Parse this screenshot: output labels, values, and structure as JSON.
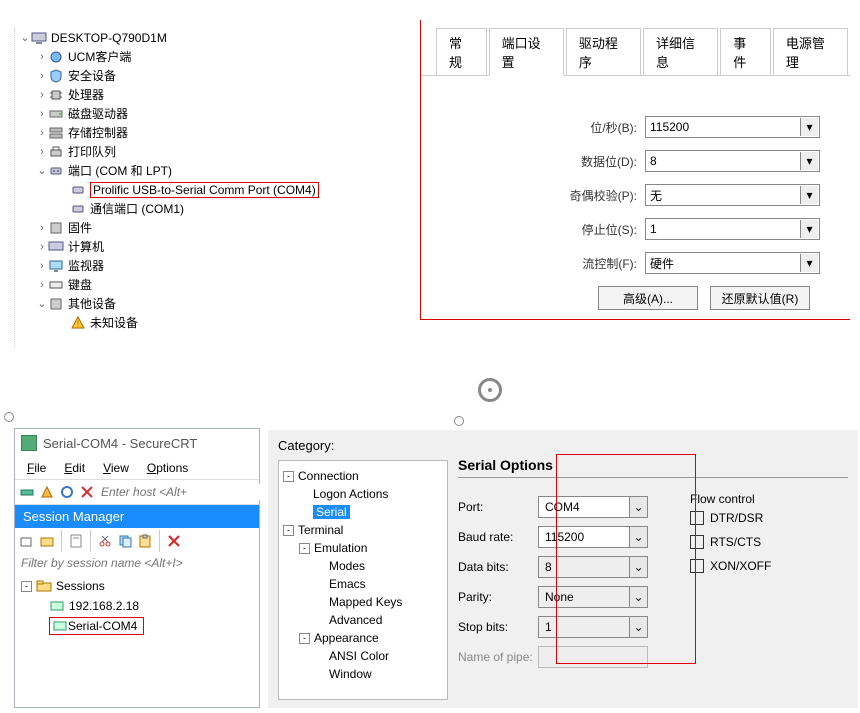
{
  "devmgr": {
    "computer": "DESKTOP-Q790D1M",
    "nodes": {
      "ucm": "UCM客户端",
      "security": "安全设备",
      "cpu": "处理器",
      "disk": "磁盘驱动器",
      "storage": "存储控制器",
      "printq": "打印队列",
      "ports": "端口 (COM 和 LPT)",
      "prolific": "Prolific USB-to-Serial Comm Port (COM4)",
      "com1": "通信端口 (COM1)",
      "firmware": "固件",
      "computer2": "计算机",
      "monitor": "监视器",
      "keyboard": "键盘",
      "other": "其他设备",
      "unknown": "未知设备"
    }
  },
  "port_dialog": {
    "tabs": {
      "general": "常规",
      "port_settings": "端口设置",
      "driver": "驱动程序",
      "details": "详细信息",
      "events": "事件",
      "power": "电源管理"
    },
    "fields": {
      "baud_label": "位/秒(B):",
      "baud_value": "115200",
      "databits_label": "数据位(D):",
      "databits_value": "8",
      "parity_label": "奇偶校验(P):",
      "parity_value": "无",
      "stopbits_label": "停止位(S):",
      "stopbits_value": "1",
      "flow_label": "流控制(F):",
      "flow_value": "硬件"
    },
    "buttons": {
      "advanced": "高级(A)...",
      "restore": "还原默认值(R)"
    }
  },
  "securecrt": {
    "title": "Serial-COM4 - SecureCRT",
    "menu": {
      "file": "File",
      "edit": "Edit",
      "view": "View",
      "options": "Options"
    },
    "host_placeholder": "Enter host <Alt+",
    "session_manager": "Session Manager",
    "filter_placeholder": "Filter by session name <Alt+I>",
    "sessions_root": "Sessions",
    "session1": "192.168.2.18",
    "session2": "Serial-COM4"
  },
  "category_panel": {
    "label": "Category:",
    "tree": {
      "connection": "Connection",
      "logon": "Logon Actions",
      "serial": "Serial",
      "terminal": "Terminal",
      "emulation": "Emulation",
      "modes": "Modes",
      "emacs": "Emacs",
      "mapped": "Mapped Keys",
      "advanced": "Advanced",
      "appearance": "Appearance",
      "ansi": "ANSI Color",
      "window": "Window"
    },
    "serial": {
      "header": "Serial Options",
      "port_label": "Port:",
      "port_value": "COM4",
      "baud_label": "Baud rate:",
      "baud_value": "115200",
      "databits_label": "Data bits:",
      "databits_value": "8",
      "parity_label": "Parity:",
      "parity_value": "None",
      "stopbits_label": "Stop bits:",
      "stopbits_value": "1",
      "pipe_label": "Name of pipe:",
      "flow_label": "Flow control",
      "dtr": "DTR/DSR",
      "rts": "RTS/CTS",
      "xon": "XON/XOFF"
    }
  }
}
